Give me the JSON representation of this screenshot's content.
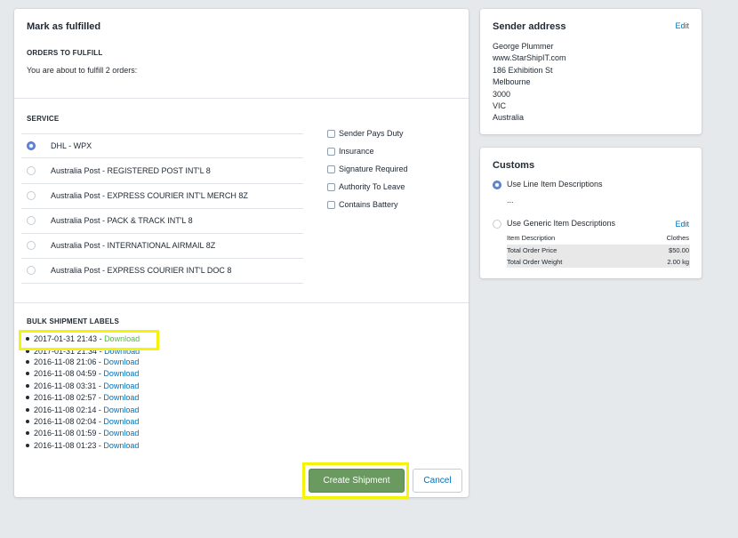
{
  "main": {
    "title": "Mark as fulfilled",
    "orders_heading": "ORDERS TO FULFILL",
    "orders_text": "You are about to fulfill 2 orders:",
    "service_heading": "SERVICE",
    "services": [
      {
        "label": "DHL - WPX",
        "selected": true
      },
      {
        "label": "Australia Post - REGISTERED POST INT'L 8",
        "selected": false
      },
      {
        "label": "Australia Post - EXPRESS COURIER INT'L MERCH 8Z",
        "selected": false
      },
      {
        "label": "Australia Post - PACK & TRACK INT'L 8",
        "selected": false
      },
      {
        "label": "Australia Post - INTERNATIONAL AIRMAIL 8Z",
        "selected": false
      },
      {
        "label": "Australia Post - EXPRESS COURIER INT'L DOC 8",
        "selected": false
      }
    ],
    "options": [
      {
        "label": "Sender Pays Duty",
        "checked": false
      },
      {
        "label": "Insurance",
        "checked": false
      },
      {
        "label": "Signature Required",
        "checked": false
      },
      {
        "label": "Authority To Leave",
        "checked": false
      },
      {
        "label": "Contains Battery",
        "checked": false
      }
    ],
    "bulk_heading": "BULK SHIPMENT LABELS",
    "bulk_labels": [
      {
        "date": "2017-01-31 21:43",
        "link": "Download"
      },
      {
        "date": "2017-01-31 21:34",
        "link": "Download"
      },
      {
        "date": "2016-11-08 21:06",
        "link": "Download"
      },
      {
        "date": "2016-11-08 04:59",
        "link": "Download"
      },
      {
        "date": "2016-11-08 03:31",
        "link": "Download"
      },
      {
        "date": "2016-11-08 02:57",
        "link": "Download"
      },
      {
        "date": "2016-11-08 02:14",
        "link": "Download"
      },
      {
        "date": "2016-11-08 02:04",
        "link": "Download"
      },
      {
        "date": "2016-11-08 01:59",
        "link": "Download"
      },
      {
        "date": "2016-11-08 01:23",
        "link": "Download"
      }
    ],
    "separator": " - ",
    "create_button": "Create Shipment",
    "cancel_button": "Cancel"
  },
  "sender": {
    "title": "Sender address",
    "edit": "Edit",
    "lines": [
      "George Plummer",
      "www.StarShipIT.com",
      "186 Exhibition St",
      "Melbourne",
      "3000",
      "VIC",
      "Australia"
    ]
  },
  "customs": {
    "title": "Customs",
    "option1": "Use Line Item Descriptions",
    "ellipsis": "...",
    "option2": "Use Generic Item Descriptions",
    "edit": "Edit",
    "rows": [
      {
        "key": "Item Description",
        "value": "Clothes"
      },
      {
        "key": "Total Order Price",
        "value": "$50.00"
      },
      {
        "key": "Total Order Weight",
        "value": "2.00 kg"
      }
    ]
  },
  "colors": {
    "primary_button": "#6a9a5f",
    "link": "#006fbb",
    "highlight": "#f5f20c",
    "background": "#e6e9ec"
  }
}
